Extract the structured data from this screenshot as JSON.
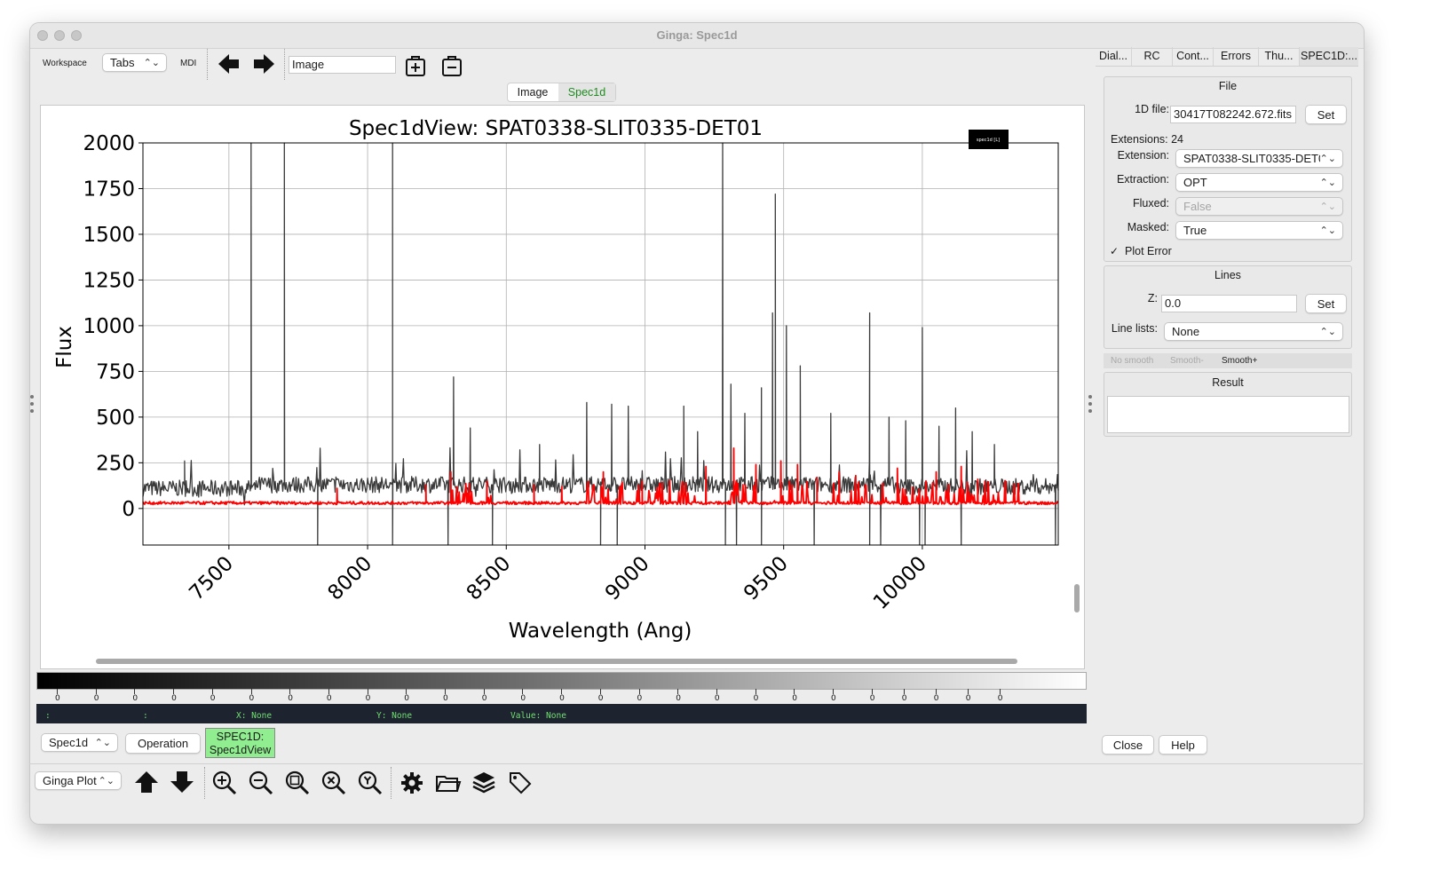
{
  "window": {
    "title": "Ginga: Spec1d"
  },
  "toolbar": {
    "workspace_label": "Workspace",
    "layout_value": "Tabs",
    "mdi_label": "MDI",
    "workspace_name": "Image",
    "icons": [
      "arrow-left-icon",
      "arrow-right-icon",
      "add-workspace-icon",
      "remove-workspace-icon"
    ]
  },
  "channel_tabs": [
    {
      "label": "Image",
      "active": false
    },
    {
      "label": "Spec1d",
      "active": true,
      "color": "#1e8c1e"
    }
  ],
  "chart_data": {
    "type": "line",
    "title": "Spec1dView: SPAT0338-SLIT0335-DET01",
    "xlabel": "Wavelength (Ang)",
    "ylabel": "Flux",
    "xlim": [
      7190,
      10490
    ],
    "ylim": [
      -200,
      2000
    ],
    "xticks": [
      "7500",
      "8000",
      "8500",
      "9000",
      "9500",
      "10000"
    ],
    "yticks": [
      "2000",
      "1750",
      "1500",
      "1250",
      "1000",
      "750",
      "500",
      "250",
      "0"
    ],
    "legend_text": "spec1d [L]",
    "legend_placement": "top-right",
    "grid": true,
    "series": [
      {
        "color": "#3a3a3a",
        "baseline": 130,
        "noise": 45,
        "lines": [
          [
            7580,
            2000
          ],
          [
            7700,
            2000
          ],
          [
            8090,
            2000
          ],
          [
            9280,
            2000
          ],
          [
            9470,
            1720
          ],
          [
            9460,
            1070
          ],
          [
            9510,
            1000
          ],
          [
            9560,
            780
          ],
          [
            9810,
            1070
          ],
          [
            10000,
            990
          ],
          [
            8310,
            720
          ],
          [
            9310,
            680
          ],
          [
            9420,
            660
          ],
          [
            8790,
            580
          ],
          [
            8880,
            570
          ],
          [
            8940,
            560
          ],
          [
            9140,
            560
          ],
          [
            9360,
            520
          ],
          [
            10120,
            550
          ],
          [
            7340,
            260
          ],
          [
            8370,
            440
          ],
          [
            8620,
            350
          ],
          [
            9190,
            420
          ],
          [
            9670,
            520
          ],
          [
            9880,
            500
          ],
          [
            9940,
            480
          ],
          [
            10060,
            450
          ],
          [
            10180,
            420
          ],
          [
            10260,
            350
          ]
        ],
        "dips": [
          [
            7820,
            -200
          ],
          [
            8090,
            -200
          ],
          [
            8290,
            -200
          ],
          [
            8450,
            -200
          ],
          [
            8840,
            -200
          ],
          [
            8900,
            -200
          ],
          [
            9290,
            -200
          ],
          [
            9330,
            -200
          ],
          [
            9420,
            -200
          ],
          [
            9610,
            -200
          ],
          [
            9810,
            -200
          ],
          [
            9850,
            -200
          ],
          [
            9990,
            -200
          ],
          [
            10010,
            -200
          ],
          [
            10140,
            -200
          ],
          [
            10480,
            -200
          ]
        ]
      },
      {
        "color": "#ff0000",
        "baseline": 30,
        "noise": 8,
        "lines": [
          [
            9320,
            330
          ],
          [
            9490,
            260
          ],
          [
            9400,
            240
          ],
          [
            9550,
            240
          ],
          [
            9220,
            230
          ],
          [
            9910,
            220
          ],
          [
            10140,
            230
          ],
          [
            8850,
            200
          ],
          [
            8300,
            200
          ],
          [
            7890,
            110
          ],
          [
            8210,
            130
          ],
          [
            8430,
            150
          ],
          [
            8600,
            130
          ],
          [
            8700,
            120
          ],
          [
            8990,
            150
          ],
          [
            9620,
            170
          ],
          [
            9700,
            200
          ],
          [
            9760,
            180
          ],
          [
            10050,
            200
          ],
          [
            10200,
            160
          ],
          [
            10300,
            150
          ]
        ]
      }
    ]
  },
  "colorbar": {
    "ticks": [
      "0",
      "0",
      "0",
      "0",
      "0",
      "0",
      "0",
      "0",
      "0",
      "0",
      "0",
      "0",
      "0",
      "0",
      "0",
      "0",
      "0",
      "0",
      "0",
      "0",
      "0",
      "0",
      "0",
      "0",
      "0",
      "0"
    ]
  },
  "statusbar": {
    "left1": ":",
    "left2": ":",
    "x": "X: None",
    "y": "Y: None",
    "value": "Value: None"
  },
  "operation_bar": {
    "channel": "Spec1d",
    "operation_label": "Operation",
    "plugin_label": "SPEC1D:\nSpec1dView"
  },
  "bottom_toolbar": {
    "viewer": "Ginga Plot",
    "icons": [
      "up-arrow-icon",
      "down-arrow-icon",
      "zoom-in-icon",
      "zoom-out-icon",
      "zoom-fit-icon",
      "zoom-x-icon",
      "zoom-y-icon",
      "settings-gear-icon",
      "open-folder-icon",
      "layers-icon",
      "tags-icon"
    ]
  },
  "right_panel": {
    "tabs": [
      "Dial...",
      "RC",
      "Cont...",
      "Errors",
      "Thu...",
      "SPEC1D:..."
    ],
    "file_group": {
      "title": "File",
      "file_label": "1D file:",
      "file_value": "30417T082242.672.fits",
      "set_label": "Set",
      "extensions_text": "Extensions: 24",
      "extension_label": "Extension:",
      "extension_value": "SPAT0338-SLIT0335-DET0",
      "extraction_label": "Extraction:",
      "extraction_value": "OPT",
      "fluxed_label": "Fluxed:",
      "fluxed_value": "False",
      "masked_label": "Masked:",
      "masked_value": "True",
      "plot_error_label": "Plot Error",
      "plot_error_checked": true
    },
    "lines_group": {
      "title": "Lines",
      "z_label": "Z:",
      "z_value": "0.0",
      "set_label": "Set",
      "line_lists_label": "Line lists:",
      "line_lists_value": "None"
    },
    "smooth_buttons": [
      "No smooth",
      "Smooth-",
      "Smooth+"
    ],
    "result_title": "Result",
    "close_label": "Close",
    "help_label": "Help"
  }
}
